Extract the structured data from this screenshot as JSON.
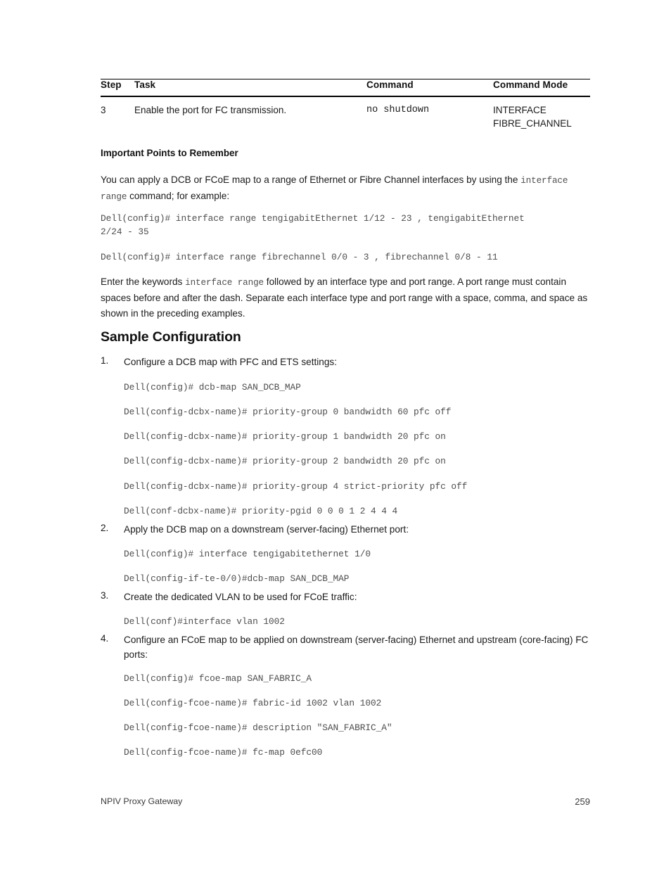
{
  "table": {
    "headers": [
      "Step",
      "Task",
      "Command",
      "Command Mode"
    ],
    "rows": [
      {
        "step": "3",
        "task": "Enable the port for FC transmission.",
        "command": "no shutdown",
        "mode": "INTERFACE\nFIBRE_CHANNEL"
      }
    ]
  },
  "important_points": {
    "heading": "Important Points to Remember",
    "para_a": "You can apply a DCB or FCoE map to a range of Ethernet or Fibre Channel interfaces by using the",
    "para_a_code": "interface range",
    "para_a_tail": "command; for example:",
    "code_1": "Dell(config)# interface range tengigabitEthernet 1/12 - 23 , tengigabitEthernet\n2/24 - 35",
    "code_2": "Dell(config)# interface range fibrechannel 0/0 - 3 , fibrechannel 0/8 - 11",
    "para_b_head": "Enter the keywords",
    "para_b_code": "interface range",
    "para_b_tail": "followed by an interface type and port range. A port range must contain spaces before and after the dash. Separate each interface type and port range with a space, comma, and space as shown in the preceding examples."
  },
  "sample_configuration": {
    "heading": "Sample Configuration",
    "steps": [
      {
        "num": "1.",
        "text": "Configure a DCB map with PFC and ETS settings:",
        "code_lines": [
          "Dell(config)# dcb-map SAN_DCB_MAP",
          "Dell(config-dcbx-name)# priority-group 0 bandwidth 60 pfc off",
          "Dell(config-dcbx-name)# priority-group 1 bandwidth 20 pfc on",
          "Dell(config-dcbx-name)# priority-group 2 bandwidth 20 pfc on",
          "Dell(config-dcbx-name)# priority-group 4 strict-priority pfc off",
          "Dell(conf-dcbx-name)# priority-pgid 0 0 0 1 2 4 4 4"
        ]
      },
      {
        "num": "2.",
        "text": "Apply the DCB map on a downstream (server-facing) Ethernet port:",
        "code_lines": [
          "Dell(config)# interface tengigabitethernet 1/0",
          "Dell(config-if-te-0/0)#dcb-map SAN_DCB_MAP"
        ]
      },
      {
        "num": "3.",
        "text": "Create the dedicated VLAN to be used for FCoE traffic:",
        "code_lines": [
          "Dell(conf)#interface vlan 1002"
        ]
      },
      {
        "num": "4.",
        "text": "Configure an FCoE map to be applied on downstream (server-facing) Ethernet and upstream (core-facing) FC ports:",
        "code_lines": [
          "Dell(config)# fcoe-map SAN_FABRIC_A",
          "Dell(config-fcoe-name)# fabric-id 1002 vlan 1002",
          "Dell(config-fcoe-name)# description \"SAN_FABRIC_A\"",
          "Dell(config-fcoe-name)# fc-map 0efc00"
        ]
      }
    ]
  },
  "footer": {
    "chapter": "NPIV Proxy Gateway",
    "page_number": "259"
  }
}
